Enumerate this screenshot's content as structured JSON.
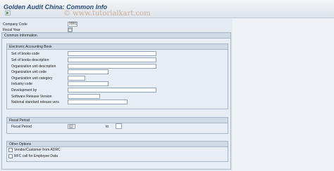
{
  "app": {
    "title": "Golden Audit China: Common Info",
    "watermark": "© www.tutorialkart.com"
  },
  "header": {
    "company_code_label": "Company Code",
    "company_code_value": "0001",
    "fiscal_year_label": "Fiscal Year"
  },
  "common_info": {
    "title": "Common Information"
  },
  "accounting_book": {
    "title": "Electronic Accounting Book",
    "fields": [
      {
        "label": "Set of books code",
        "value": ""
      },
      {
        "label": "Set of books description",
        "value": ""
      },
      {
        "label": "Organization unit description",
        "value": ""
      },
      {
        "label": "Organization unit code",
        "value": ""
      },
      {
        "label": "Organization unit category",
        "value": ""
      },
      {
        "label": "Industry code",
        "value": ""
      },
      {
        "label": "Development by",
        "value": ""
      },
      {
        "label": "Software Release Version",
        "value": ""
      },
      {
        "label": "National standard release vers",
        "value": ""
      }
    ]
  },
  "fiscal_period": {
    "title": "Fiscal Period",
    "label": "Fiscal Period",
    "to_label": "to"
  },
  "other_options": {
    "title": "Other Options",
    "options": [
      {
        "label": "Vendor/Customer from ADRC"
      },
      {
        "label": "RFC call for Employee Data"
      }
    ]
  }
}
